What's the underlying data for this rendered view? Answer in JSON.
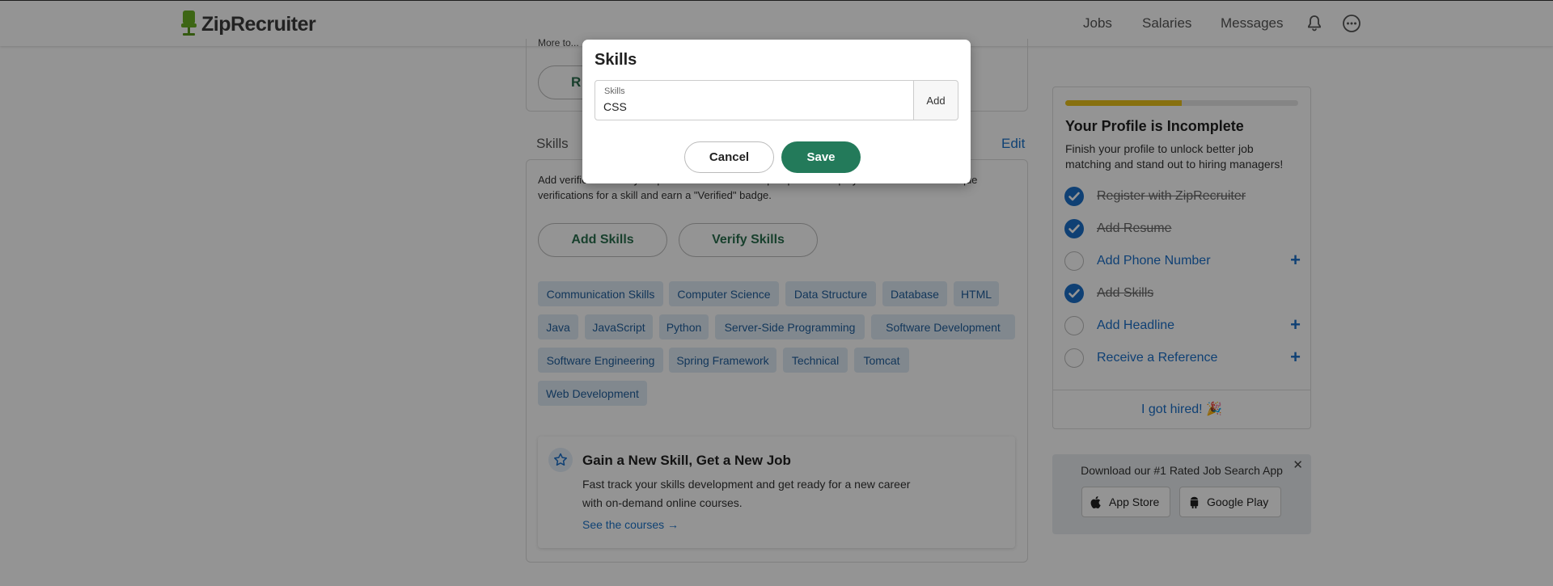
{
  "header": {
    "brand": "ZipRecruiter",
    "nav": [
      "Jobs",
      "Salaries",
      "Messages"
    ]
  },
  "top_card": {
    "text": "More to...",
    "button_label": "R"
  },
  "skills_section": {
    "heading": "Skills",
    "edit_label": "Edit",
    "description": "Add verified skills to your profile and stand out to prospective employers! Receive three unique verifications for a skill and earn a \"Verified\" badge.",
    "add_button": "Add Skills",
    "verify_button": "Verify Skills",
    "chips": [
      "Communication Skills",
      "Computer Science",
      "Data Structure",
      "Database",
      "HTML",
      "Java",
      "JavaScript",
      "Python",
      "Server-Side Programming",
      "Software Development",
      "Software Engineering",
      "Spring Framework",
      "Technical",
      "Tomcat",
      "Web Development"
    ]
  },
  "course_card": {
    "title": "Gain a New Skill, Get a New Job",
    "description": "Fast track your skills development and get ready for a new career with on-demand online courses.",
    "link": "See the courses →"
  },
  "profile": {
    "progress_fraction": 0.5,
    "title": "Your Profile is Incomplete",
    "description": "Finish your profile to unlock better job matching and stand out to hiring managers!",
    "tasks": [
      {
        "label": "Register with ZipRecruiter",
        "done": true
      },
      {
        "label": "Add Resume",
        "done": true
      },
      {
        "label": "Add Phone Number",
        "done": false
      },
      {
        "label": "Add Skills",
        "done": true
      },
      {
        "label": "Add Headline",
        "done": false
      },
      {
        "label": "Receive a Reference",
        "done": false
      }
    ],
    "hired_label": "I got hired! 🎉"
  },
  "app_promo": {
    "title": "Download our #1 Rated Job Search App",
    "app_store": "App Store",
    "google_play": "Google Play",
    "close": "✕"
  },
  "modal": {
    "title": "Skills",
    "field_label": "Skills",
    "field_value": "CSS",
    "add_label": "Add",
    "cancel_label": "Cancel",
    "save_label": "Save"
  },
  "colors": {
    "brand_green": "#237a5a",
    "link_blue": "#1a6fc9",
    "progress_yellow": "#e8c21a",
    "chip_bg": "#dfeaf5"
  }
}
